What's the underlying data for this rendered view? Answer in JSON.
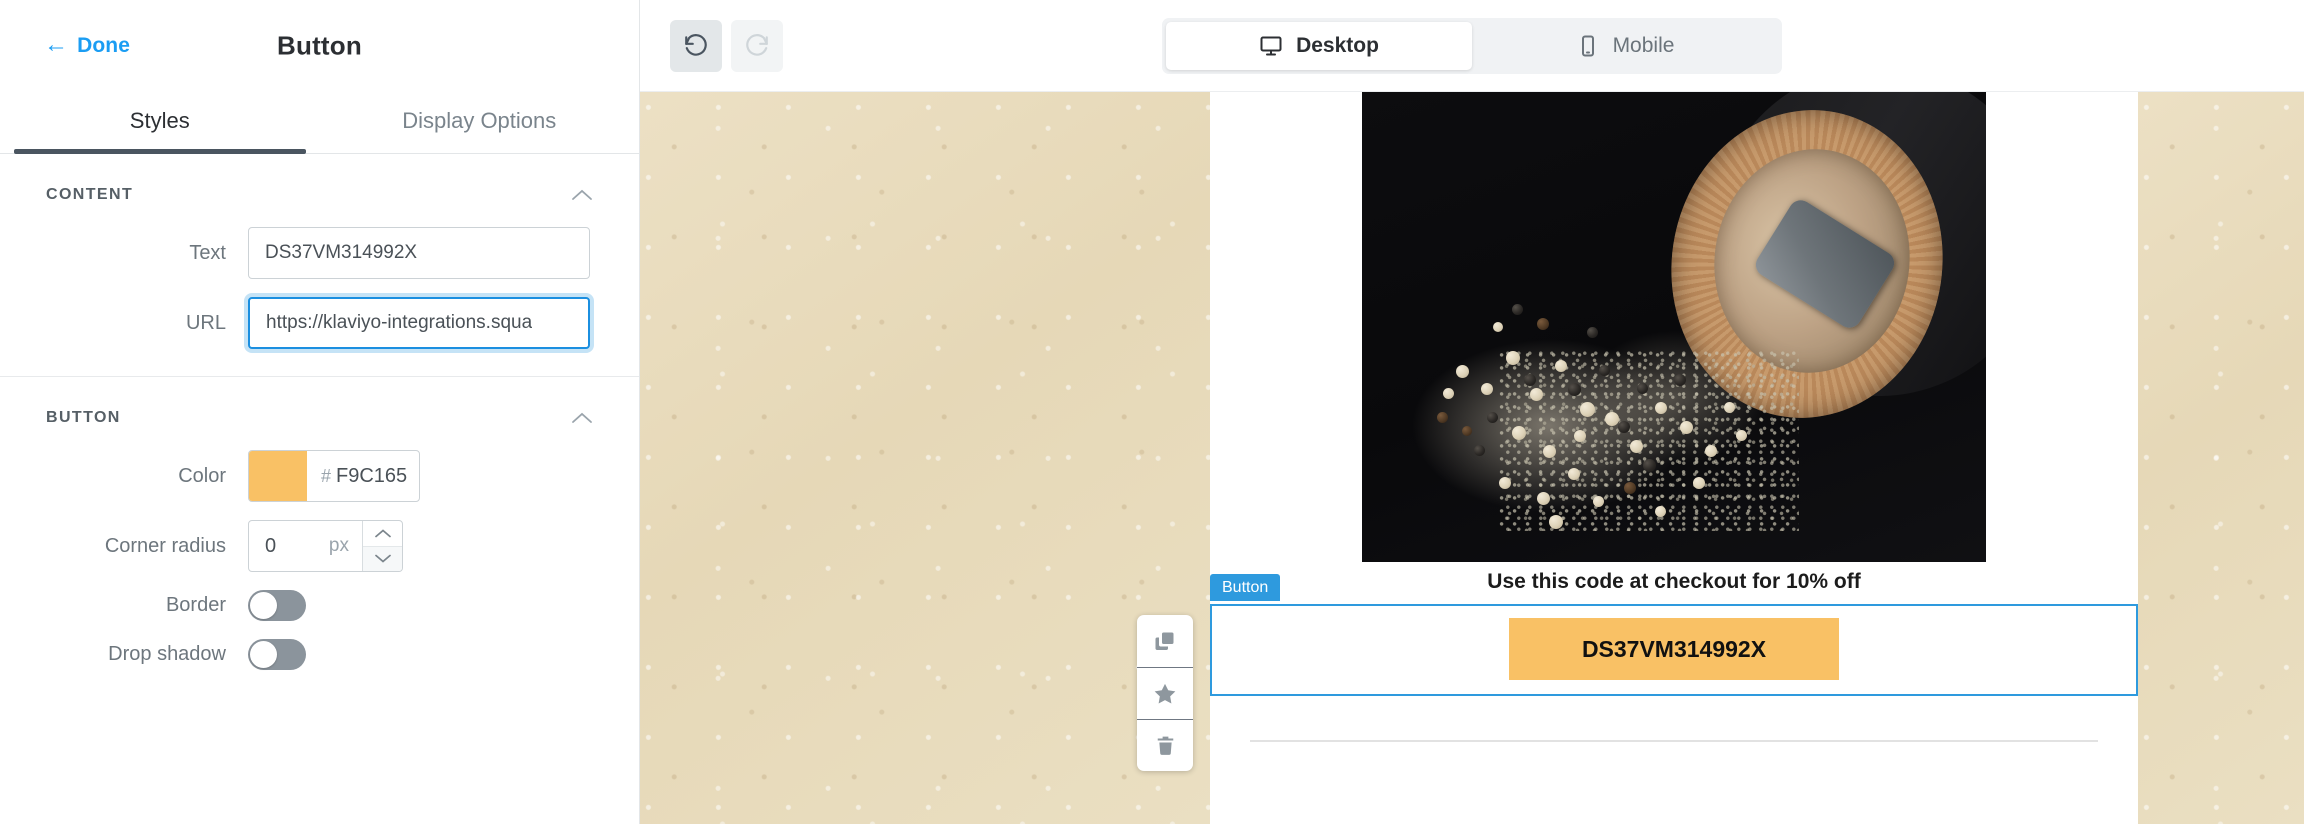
{
  "left_panel": {
    "done_label": "Done",
    "title": "Button",
    "tabs": [
      {
        "label": "Styles",
        "active": true
      },
      {
        "label": "Display Options",
        "active": false
      }
    ],
    "sections": [
      {
        "title": "CONTENT",
        "collapse_icon": "chevron-up-icon",
        "fields": [
          {
            "label": "Text",
            "value": "DS37VM314992X",
            "focused": false
          },
          {
            "label": "URL",
            "value": "https://klaviyo-integrations.squa",
            "focused": true
          }
        ]
      },
      {
        "title": "BUTTON",
        "collapse_icon": "chevron-up-icon",
        "color": {
          "label": "Color",
          "hash": "#",
          "hex": "F9C165",
          "swatch": "#F9C165"
        },
        "corner_radius": {
          "label": "Corner radius",
          "value": "0",
          "unit": "px"
        },
        "border": {
          "label": "Border",
          "on": false
        },
        "drop_shadow": {
          "label": "Drop shadow",
          "on": false
        }
      }
    ]
  },
  "toolbar": {
    "undo_icon": "undo-icon",
    "redo_icon": "redo-icon",
    "undo_enabled": true,
    "redo_enabled": false,
    "devices": [
      {
        "label": "Desktop",
        "icon": "desktop-icon",
        "active": true
      },
      {
        "label": "Mobile",
        "icon": "mobile-icon",
        "active": false
      }
    ]
  },
  "canvas": {
    "hero_image_alt": "pepper-grinder-with-peppercorns",
    "caption": "Use this code at checkout for 10% off",
    "selected_block": {
      "tag": "Button",
      "cta_label": "DS37VM314992X",
      "cta_color": "#F9C165",
      "selection_color": "#2E9ADE"
    },
    "action_rail": [
      {
        "name": "duplicate-icon",
        "title": "Duplicate"
      },
      {
        "name": "star-icon",
        "title": "Save"
      },
      {
        "name": "trash-icon",
        "title": "Delete"
      }
    ]
  }
}
